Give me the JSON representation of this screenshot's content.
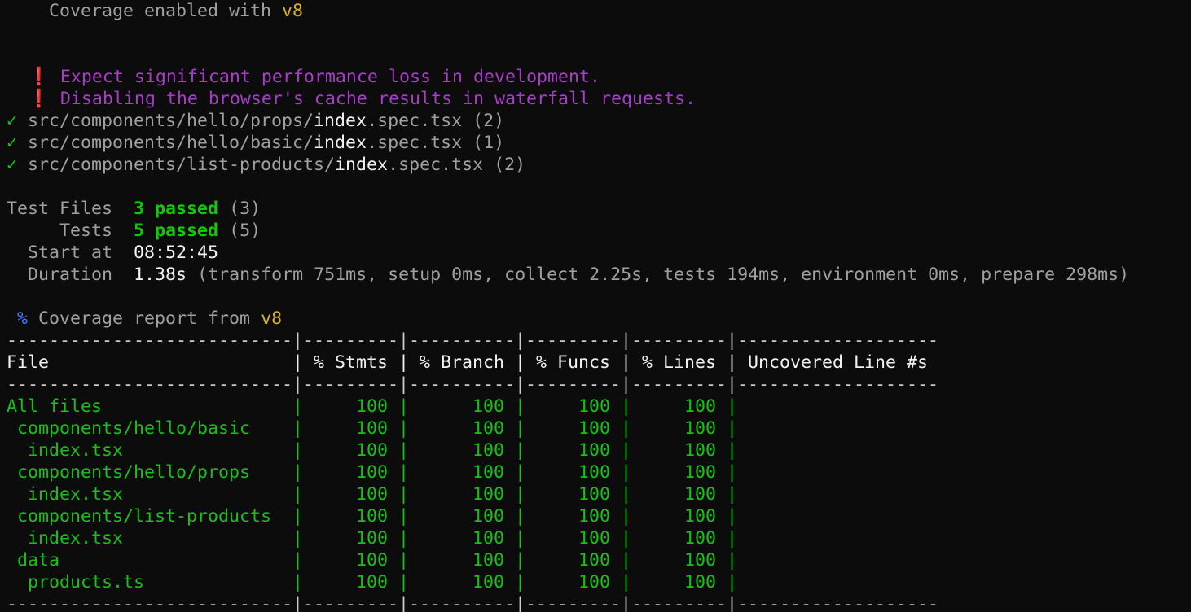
{
  "header": {
    "coverage_prefix": "Coverage enabled with ",
    "coverage_provider": "v8"
  },
  "warnings": [
    {
      "icon": "❗",
      "text": "Expect significant performance loss in development."
    },
    {
      "icon": "❗",
      "text": "Disabling the browser's cache results in waterfall requests."
    }
  ],
  "test_files": [
    {
      "check": "✓",
      "pre": "src/components/hello/props/",
      "name": "index",
      "post": ".spec.tsx",
      "count": "(2)"
    },
    {
      "check": "✓",
      "pre": "src/components/hello/basic/",
      "name": "index",
      "post": ".spec.tsx",
      "count": "(1)"
    },
    {
      "check": "✓",
      "pre": "src/components/list-products/",
      "name": "index",
      "post": ".spec.tsx",
      "count": "(2)"
    }
  ],
  "summary": {
    "test_files_label": "Test Files",
    "test_files_passed": "3 passed",
    "test_files_total": "(3)",
    "tests_label": "Tests",
    "tests_passed": "5 passed",
    "tests_total": "(5)",
    "start_label": "Start at",
    "start_value": "08:52:45",
    "duration_label": "Duration",
    "duration_value": "1.38s",
    "duration_detail": "(transform 751ms, setup 0ms, collect 2.25s, tests 194ms, environment 0ms, prepare 298ms)"
  },
  "report": {
    "icon": "%",
    "prefix": "Coverage report from ",
    "provider": "v8"
  },
  "table": {
    "separator": "---------------------------|---------|----------|---------|---------|-------------------",
    "header": "File                       | % Stmts | % Branch | % Funcs | % Lines | Uncovered Line #s ",
    "rows": [
      "All files                  |     100 |      100 |     100 |     100 |                   ",
      " components/hello/basic    |     100 |      100 |     100 |     100 |                   ",
      "  index.tsx                |     100 |      100 |     100 |     100 |                   ",
      " components/hello/props    |     100 |      100 |     100 |     100 |                   ",
      "  index.tsx                |     100 |      100 |     100 |     100 |                   ",
      " components/list-products  |     100 |      100 |     100 |     100 |                   ",
      "  index.tsx                |     100 |      100 |     100 |     100 |                   ",
      " data                      |     100 |      100 |     100 |     100 |                   ",
      "  products.ts              |     100 |      100 |     100 |     100 |                   "
    ]
  }
}
